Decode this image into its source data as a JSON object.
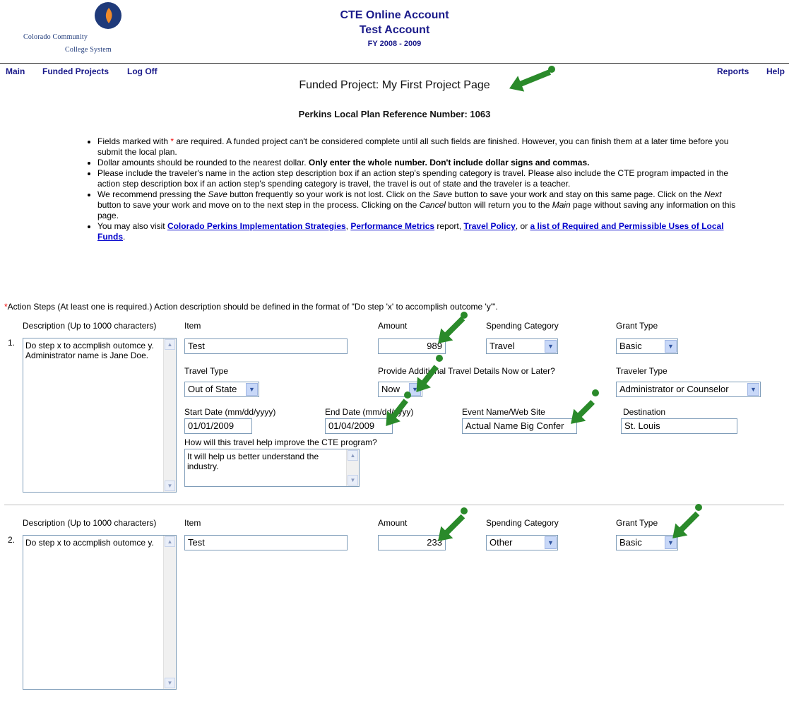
{
  "header": {
    "logo_line1": "Colorado Community",
    "logo_line2": "College System",
    "title": "CTE Online Account",
    "account": "Test Account",
    "fiscal_year": "FY 2008 - 2009"
  },
  "nav": {
    "main": "Main",
    "funded_projects": "Funded Projects",
    "log_off": "Log Off",
    "reports": "Reports",
    "help": "Help"
  },
  "page": {
    "title": "Funded Project: My First Project Page",
    "plan_ref": "Perkins Local Plan Reference Number: 1063"
  },
  "instructions": {
    "b1_pre": "Fields marked with ",
    "b1_star": "*",
    "b1_post": " are required. A funded project can't be considered complete until all such fields are finished. However, you can finish them at a later time before you submit the local plan.",
    "b2_pre": "Dollar amounts should be rounded to the nearest dollar. ",
    "b2_bold": "Only enter the whole number. Don't include dollar signs and commas.",
    "b3": "Please include the traveler's name in the action step description box if an action step's spending category is travel. Please also include the CTE program impacted in the action step description box if an action step's spending category is travel, the travel is out of state and the traveler is a teacher.",
    "b4_a": "We recommend pressing the ",
    "b4_save1": "Save",
    "b4_b": " button frequently so your work is not lost. Click on the ",
    "b4_save2": "Save",
    "b4_c": " button to save your work and stay on this same page. Click on the ",
    "b4_next": "Next",
    "b4_d": " button to save your work and move on to the next step in the process. Clicking on the ",
    "b4_cancel": "Cancel",
    "b4_e": " button will return you to the ",
    "b4_main": "Main",
    "b4_f": " page without saving any information on this page.",
    "b5_pre": "You may also visit ",
    "link_strategies": "Colorado Perkins Implementation Strategies",
    "sep1": ", ",
    "link_metrics": "Performance Metrics",
    "b5_mid": " report, ",
    "link_travel": "Travel Policy",
    "b5_or": ", or ",
    "link_uses": "a list of Required and Permissible Uses of Local Funds",
    "b5_end": "."
  },
  "action_steps": {
    "star": "*",
    "title": "Action Steps (At least one is required.) Action description should be defined in the format of \"Do step 'x' to accomplish outcome 'y'\".",
    "labels": {
      "description": "Description (Up to 1000 characters)",
      "item": "Item",
      "amount": "Amount",
      "spending_category": "Spending Category",
      "grant_type": "Grant Type",
      "travel_type": "Travel Type",
      "details_later": "Provide Additional Travel Details Now or Later?",
      "traveler_type": "Traveler Type",
      "start_date": "Start Date (mm/dd/yyyy)",
      "end_date": "End Date (mm/dd/yyyy)",
      "event_name": "Event Name/Web Site",
      "destination": "Destination",
      "how_help": "How will this travel help improve the CTE program?"
    },
    "steps": [
      {
        "number": "1.",
        "description": "Do step x to accmplish outomce y. Administrator name is Jane Doe.",
        "item": "Test",
        "amount": "989",
        "spending_category": "Travel",
        "grant_type": "Basic",
        "travel_type": "Out of State",
        "details_later": "Now",
        "traveler_type": "Administrator or Counselor",
        "start_date": "01/01/2009",
        "end_date": "01/04/2009",
        "event_name": "Actual Name Big Confer",
        "destination": "St. Louis",
        "how_help": "It will help us better understand the industry."
      },
      {
        "number": "2.",
        "description": "Do step x to accmplish outomce y.",
        "item": "Test",
        "amount": "233",
        "spending_category": "Other",
        "grant_type": "Basic"
      }
    ]
  },
  "colors": {
    "nav_text": "#1a1a8a",
    "link": "#0000cc",
    "required": "#ee0000",
    "annotation_arrow": "#2a8a2a",
    "input_border": "#7f9db9"
  }
}
